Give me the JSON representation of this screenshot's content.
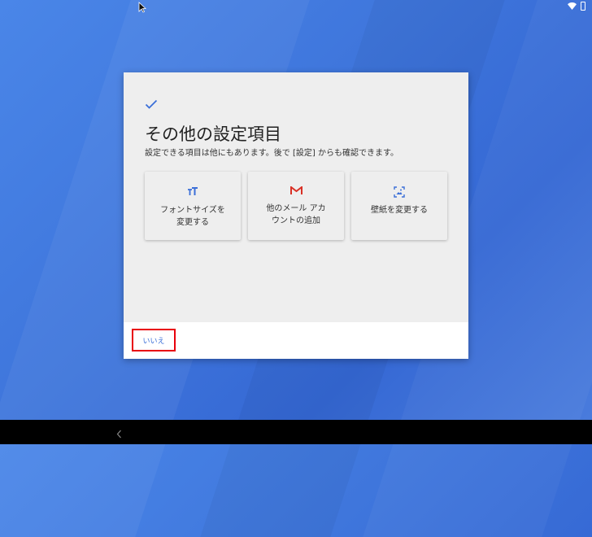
{
  "status_bar": {
    "icons": [
      "wifi-icon",
      "battery-icon"
    ]
  },
  "dialog": {
    "title": "その他の設定項目",
    "subtitle": "設定できる項目は他にもあります。後で [設定] からも確認できます。",
    "cards": [
      {
        "label": "フォントサイズを変更する",
        "icon": "font-size-icon",
        "icon_color": "#3b6fd8"
      },
      {
        "label": "他のメール アカウントの追加",
        "icon": "gmail-icon",
        "icon_color": "#d93025"
      },
      {
        "label": "壁紙を変更する",
        "icon": "wallpaper-icon",
        "icon_color": "#3b6fd8"
      }
    ],
    "no_button_label": "いいえ"
  },
  "nav_bar": {
    "back_icon": "back-chevron-icon"
  },
  "colors": {
    "accent": "#3b6fd8",
    "highlight_border": "#e8000b"
  }
}
